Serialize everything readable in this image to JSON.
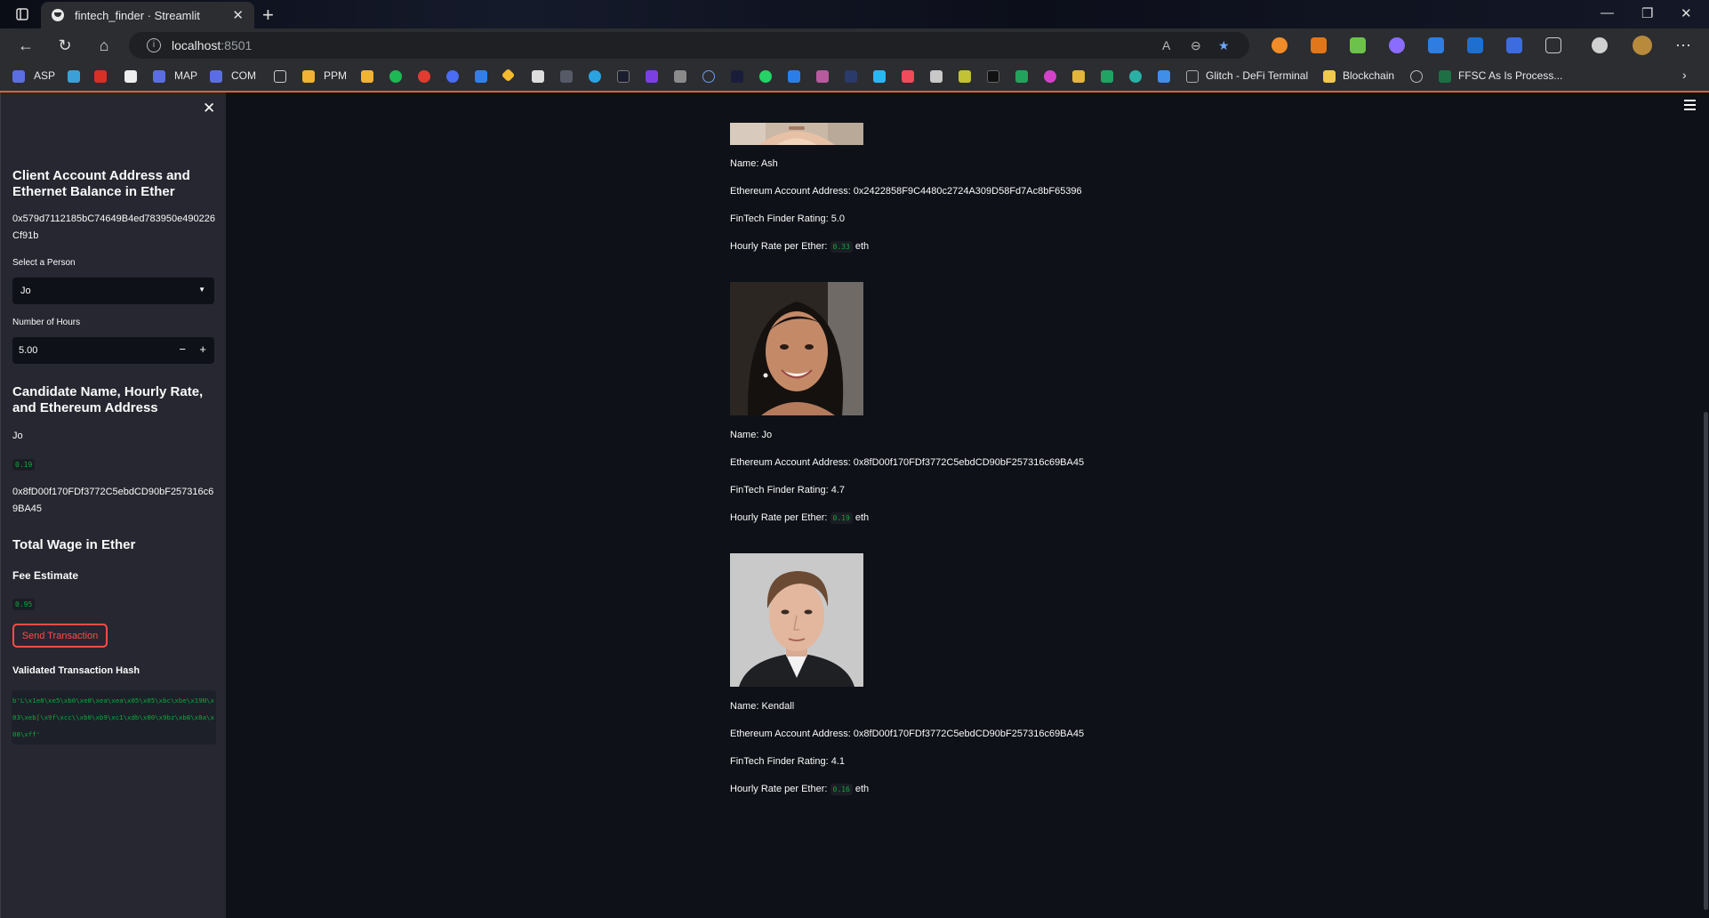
{
  "browser": {
    "tab_title": "fintech_finder · Streamlit",
    "url_host": "localhost",
    "url_port": ":8501"
  },
  "bookmarks": [
    {
      "label": "ASP"
    },
    {
      "label": "MAP"
    },
    {
      "label": "COM"
    },
    {
      "label": "PPM"
    },
    {
      "label": "Glitch - DeFi Terminal"
    },
    {
      "label": "Blockchain"
    },
    {
      "label": "FFSC As Is Process..."
    }
  ],
  "sidebar": {
    "client_header": "Client Account Address and Ethernet Balance in Ether",
    "client_address": "0x579d7112185bC74649B4ed783950e490226Cf91b",
    "select_label": "Select a Person",
    "selected_person": "Jo",
    "hours_label": "Number of Hours",
    "hours_value": "5.00",
    "candidate_header": "Candidate Name, Hourly Rate, and Ethereum Address",
    "candidate_name": "Jo",
    "candidate_rate": "0.19",
    "candidate_address": "0x8fD00f170FDf3772C5ebdCD90bF257316c69BA45",
    "total_wage_header": "Total Wage in Ether",
    "fee_label": "Fee Estimate",
    "fee_value": "0.95",
    "send_button": "Send Transaction",
    "hash_label": "Validated Transaction Hash",
    "hash_value": "b'L\\x1e8\\xe5\\xb0\\xe8\\xea\\xea\\x05\\x05\\xbc\\xbe\\x19N\\x03\\xeb[\\x9f\\xcc\\\\xb0\\xb9\\xc1\\xdb\\x80\\x9bz\\xb8\\x8a\\x08\\xff'"
  },
  "candidates": [
    {
      "name_line": "Name: Ash",
      "address_line": "Ethereum Account Address: 0x2422858F9C4480c2724A309D58Fd7Ac8bF65396",
      "rating_line": "FinTech Finder Rating: 5.0",
      "rate_prefix": "Hourly Rate per Ether:",
      "rate_value": "0.33",
      "rate_unit": "eth"
    },
    {
      "name_line": "Name: Jo",
      "address_line": "Ethereum Account Address: 0x8fD00f170FDf3772C5ebdCD90bF257316c69BA45",
      "rating_line": "FinTech Finder Rating: 4.7",
      "rate_prefix": "Hourly Rate per Ether:",
      "rate_value": "0.19",
      "rate_unit": "eth"
    },
    {
      "name_line": "Name: Kendall",
      "address_line": "Ethereum Account Address: 0x8fD00f170FDf3772C5ebdCD90bF257316c69BA45",
      "rating_line": "FinTech Finder Rating: 4.1",
      "rate_prefix": "Hourly Rate per Ether:",
      "rate_value": "0.16",
      "rate_unit": "eth"
    }
  ],
  "colors": {
    "accent": "#ff4b4b",
    "code_green": "#09ab3b",
    "background": "#0e1117",
    "sidebar": "#262730"
  }
}
